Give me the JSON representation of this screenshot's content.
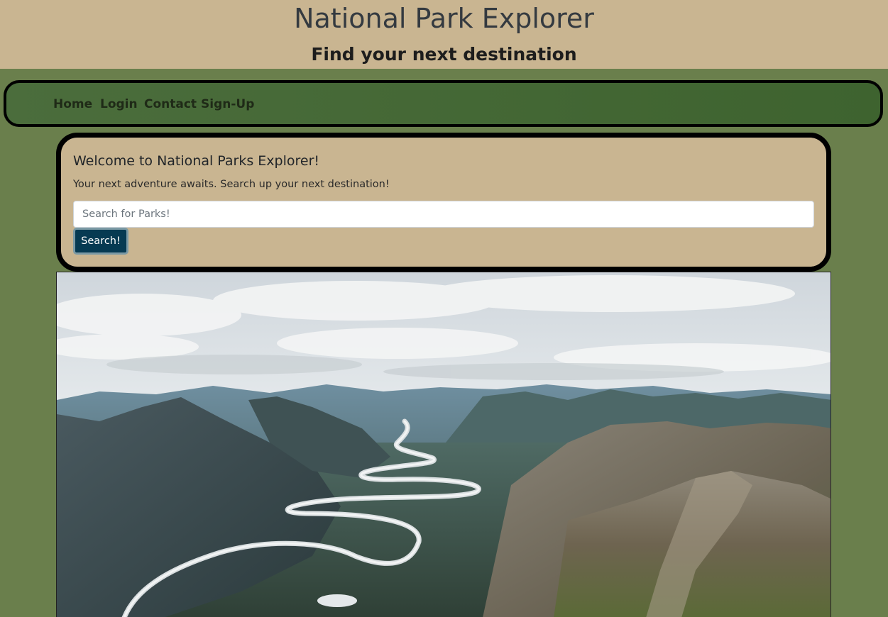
{
  "header": {
    "title": "National Park Explorer",
    "subtitle": "Find your next destination"
  },
  "nav": {
    "items": [
      "Home",
      "Login",
      "Contact",
      "Sign-Up"
    ]
  },
  "welcome": {
    "title": "Welcome to National Parks Explorer!",
    "text": "Your next adventure awaits. Search up your next destination!",
    "search_placeholder": "Search for Parks!",
    "search_value": "",
    "button_label": "Search!"
  },
  "hero": {
    "image": "aerial-mountain-river-landscape"
  },
  "colors": {
    "page_bg": "#6a7f4c",
    "header_bg": "#c9b591",
    "nav_bg": "#446a36",
    "button_bg": "#063a52"
  }
}
